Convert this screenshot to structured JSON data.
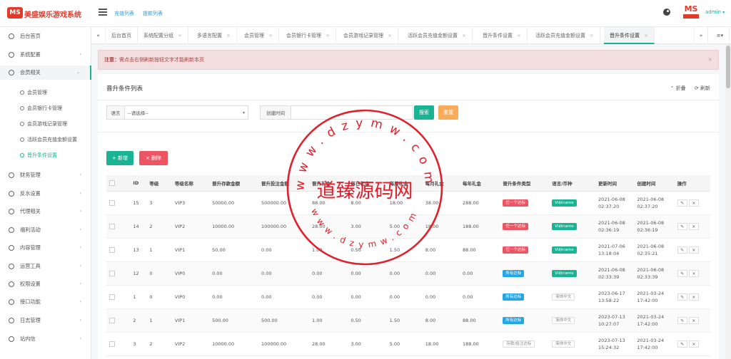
{
  "app": {
    "title": "美盛娱乐游戏系统",
    "logo_badge": "MS"
  },
  "topbar": {
    "links": [
      "充值列表",
      "提款列表"
    ],
    "user": "admin"
  },
  "sidebar": {
    "items": [
      {
        "label": "后台首页",
        "arrow": ""
      },
      {
        "label": "系统配置",
        "arrow": "›"
      },
      {
        "label": "会员相关",
        "arrow": "⌄"
      },
      {
        "label": "财务管理",
        "arrow": "›"
      },
      {
        "label": "反水设置",
        "arrow": "›"
      },
      {
        "label": "代理相关",
        "arrow": "›"
      },
      {
        "label": "福利活动",
        "arrow": "›"
      },
      {
        "label": "内容管理",
        "arrow": "›"
      },
      {
        "label": "运营工具",
        "arrow": "›"
      },
      {
        "label": "权限设置",
        "arrow": "›"
      },
      {
        "label": "接口功能",
        "arrow": "›"
      },
      {
        "label": "日志管理",
        "arrow": "›"
      },
      {
        "label": "站内信",
        "arrow": "›"
      }
    ],
    "subitems": [
      "会员管理",
      "会员银行卡管理",
      "会员游戏记录管理",
      "活跃会员充值金额设置",
      "晋升条件设置"
    ]
  },
  "tabs": [
    "后台首页",
    "系统配置分组",
    "多语言配置",
    "会员管理",
    "会员银行卡管理",
    "会员游戏记录管理",
    "活跃会员充值金额设置",
    "晋升条件设置",
    "活跃会员充值金额设置",
    "晋升条件设置"
  ],
  "alert": {
    "prefix": "注意：",
    "text": "需点击右侧刷新按钮文字才能刷新本页",
    "close": "×"
  },
  "panel": {
    "title": "晋升条件列表",
    "collapse": "⌃ 折叠",
    "refresh": "⟳ 刷新",
    "filters": {
      "lang_label": "语言",
      "lang_value": "--请选择--",
      "time_label": "创建时间",
      "search": "搜索",
      "reset": "重置"
    },
    "add": "+ 新增",
    "delete": "× 删除"
  },
  "table": {
    "headers": [
      "",
      "ID",
      "等级",
      "等级名称",
      "晋升存款金额",
      "晋升投注金额",
      "晋升礼金",
      "每日礼金",
      "每周礼金",
      "每月礼金",
      "每年礼金",
      "晋升条件类型",
      "语言/币种",
      "更新时间",
      "创建时间",
      "操作"
    ],
    "rows": [
      {
        "id": "15",
        "level": "3",
        "name": "VIP3",
        "deposit": "50000.00",
        "bet": "500000.00",
        "promo": "88.00",
        "daily": "8.00",
        "weekly": "18.00",
        "monthly": "38.00",
        "yearly": "288.00",
        "cond": "任一个达标",
        "cond_color": "red",
        "lang": "Việtname",
        "lang_color": "green",
        "updated": [
          "2021-06-08",
          "02:37:20"
        ],
        "created": [
          "2021-06-08",
          "02:37:20"
        ]
      },
      {
        "id": "14",
        "level": "2",
        "name": "VIP2",
        "deposit": "10000.00",
        "bet": "100000.00",
        "promo": "28.00",
        "daily": "3.00",
        "weekly": "5.00",
        "monthly": "18.00",
        "yearly": "188.00",
        "cond": "任一个达标",
        "cond_color": "red",
        "lang": "Việtname",
        "lang_color": "green",
        "updated": [
          "2021-06-08",
          "02:36:19"
        ],
        "created": [
          "2021-06-08",
          "02:36:19"
        ]
      },
      {
        "id": "13",
        "level": "1",
        "name": "VIP1",
        "deposit": "50.00",
        "bet": "0.00",
        "promo": "1.00",
        "daily": "0.50",
        "weekly": "1.50",
        "monthly": "8.00",
        "yearly": "88.00",
        "cond": "任一个达标",
        "cond_color": "red",
        "lang": "Việtname",
        "lang_color": "green",
        "updated": [
          "2021-07-06",
          "13:18:04"
        ],
        "created": [
          "2021-06-08",
          "02:35:21"
        ]
      },
      {
        "id": "12",
        "level": "0",
        "name": "VIP0",
        "deposit": "0.00",
        "bet": "0.00",
        "promo": "0.00",
        "daily": "0.00",
        "weekly": "0.00",
        "monthly": "0.00",
        "yearly": "0.00",
        "cond": "所有达标",
        "cond_color": "blue",
        "lang": "Việtname",
        "lang_color": "green",
        "updated": [
          "2021-06-08",
          "02:33:39"
        ],
        "created": [
          "2021-06-08",
          "02:33:39"
        ]
      },
      {
        "id": "1",
        "level": "0",
        "name": "VIP0",
        "deposit": "0.00",
        "bet": "0.00",
        "promo": "0.00",
        "daily": "0.00",
        "weekly": "0.00",
        "monthly": "0.00",
        "yearly": "0.00",
        "cond": "所有达标",
        "cond_color": "blue",
        "lang": "简体中文",
        "lang_color": "gray",
        "updated": [
          "2023-06-17",
          "13:58:22"
        ],
        "created": [
          "2021-03-24",
          "17:42:00"
        ]
      },
      {
        "id": "2",
        "level": "1",
        "name": "VIP1",
        "deposit": "500.00",
        "bet": "500.00",
        "promo": "1.00",
        "daily": "0.50",
        "weekly": "1.50",
        "monthly": "8.00",
        "yearly": "88.00",
        "cond": "所有达标",
        "cond_color": "blue",
        "lang": "简体中文",
        "lang_color": "gray",
        "updated": [
          "2023-07-13",
          "10:27:07"
        ],
        "created": [
          "2021-03-24",
          "17:42:00"
        ]
      },
      {
        "id": "3",
        "level": "2",
        "name": "VIP2",
        "deposit": "10000.00",
        "bet": "100000.00",
        "promo": "28.00",
        "daily": "3.00",
        "weekly": "5.00",
        "monthly": "18.00",
        "yearly": "188.00",
        "cond": "存款/投注达标",
        "cond_color": "gray",
        "lang": "简体中文",
        "lang_color": "gray",
        "updated": [
          "2023-07-13",
          "15:24:32"
        ],
        "created": [
          "2021-03-24",
          "17:42:00"
        ]
      }
    ]
  },
  "watermark": {
    "url": "www.dzymw.com",
    "name": "道臻源码网"
  },
  "colors": {
    "accent": "#1ab394",
    "danger": "#ed5565",
    "warning": "#f8ac59",
    "info": "#23a6e5",
    "logo": "#e23b2a",
    "stamp": "#e0202a"
  }
}
